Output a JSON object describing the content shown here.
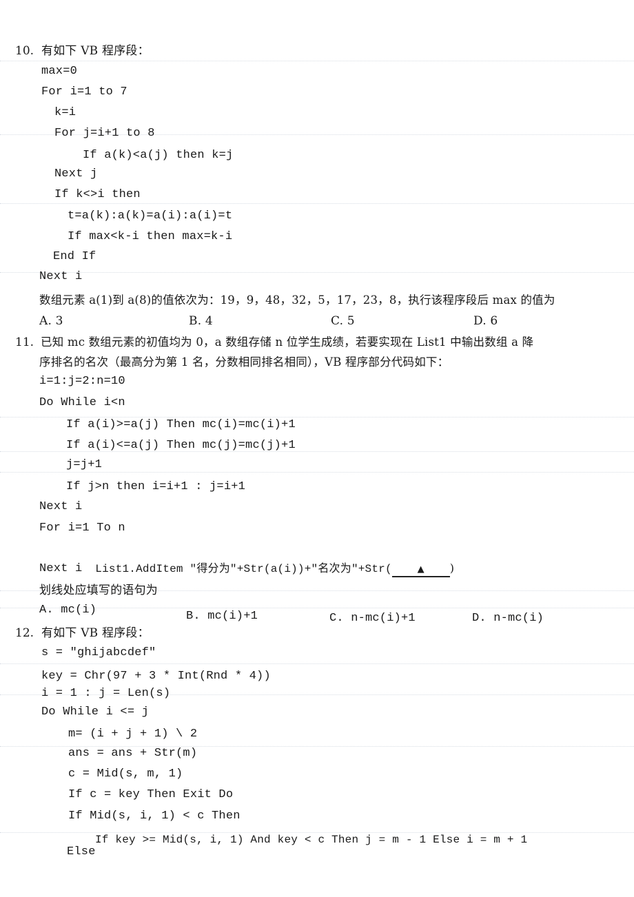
{
  "q10": {
    "number": "10.",
    "stem": "有如下 VB 程序段：",
    "code": [
      "max=0",
      "For i=1 to 7",
      "k=i",
      "For j=i+1 to 8",
      "If a(k)<a(j) then k=j",
      "Next j",
      "If k<>i then",
      "t=a(k):a(k)=a(i):a(i)=t",
      "If max<k-i then max=k-i",
      "End If",
      "Next i"
    ],
    "question": "数组元素 a(1)到 a(8)的值依次为：19，9，48，32，5，17，23，8，执行该程序段后 max 的值为",
    "options": [
      "A. 3",
      "B. 4",
      "C. 5",
      "D. 6"
    ]
  },
  "q11": {
    "number": "11.",
    "stem_line1": "已知 mc 数组元素的初值均为 0，a 数组存储 n 位学生成绩，若要实现在 List1 中输出数组 a 降",
    "stem_line2": "序排名的名次（最高分为第 1 名，分数相同排名相同），VB 程序部分代码如下：",
    "code": [
      "i=1:j=2:n=10",
      "Do While i<n",
      "If a(i)>=a(j) Then mc(i)=mc(i)+1",
      "If a(i)<=a(j) Then mc(j)=mc(j)+1",
      "j=j+1",
      "If j>n then i=i+1 : j=i+1",
      "Next i",
      "For i=1 To n",
      "List1.AddItem \"得分为\"+Str(a(i))+\"名次为\"+Str(",
      "Next i"
    ],
    "blank_marker": "▲",
    "blank_close": ")",
    "question": "划线处应填写的语句为",
    "options": [
      "A. mc(i)",
      "B. mc(i)+1",
      "C. n-mc(i)+1",
      "D. n-mc(i)"
    ]
  },
  "q12": {
    "number": "12.",
    "stem": "有如下 VB 程序段：",
    "code": [
      "s = \"ghijabcdef\"",
      "key = Chr(97 + 3 * Int(Rnd * 4))",
      "i = 1 : j = Len(s)",
      "Do While i <= j",
      "m= (i + j + 1) \\ 2",
      "ans = ans + Str(m)",
      "c = Mid(s, m, 1)",
      "If c = key Then Exit Do",
      "If Mid(s, i, 1) < c Then",
      "If key >= Mid(s, i, 1) And key < c Then j = m - 1 Else i = m + 1",
      "Else"
    ]
  }
}
